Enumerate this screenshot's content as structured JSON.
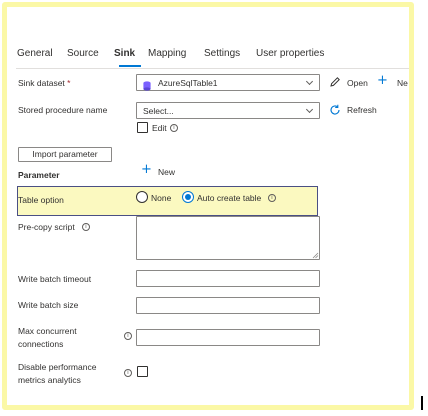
{
  "tabs": [
    {
      "label": "General"
    },
    {
      "label": "Source"
    },
    {
      "label": "Sink",
      "active": true
    },
    {
      "label": "Mapping"
    },
    {
      "label": "Settings"
    },
    {
      "label": "User properties"
    }
  ],
  "sink_dataset": {
    "label": "Sink dataset",
    "required_mark": "*",
    "value": "AzureSqlTable1",
    "open_label": "Open",
    "new_label": "Ne"
  },
  "stored_procedure": {
    "label": "Stored procedure name",
    "value": "Select...",
    "refresh_label": "Refresh",
    "edit_label": "Edit",
    "edit_checked": false
  },
  "import_parameter_label": "Import parameter",
  "parameter": {
    "label": "Parameter",
    "new_label": "New"
  },
  "table_option": {
    "label": "Table option",
    "options": [
      {
        "label": "None",
        "selected": false
      },
      {
        "label": "Auto create table",
        "selected": true
      }
    ]
  },
  "pre_copy_script": {
    "label": "Pre-copy script",
    "value": ""
  },
  "write_batch_timeout": {
    "label": "Write batch timeout",
    "value": ""
  },
  "write_batch_size": {
    "label": "Write batch size",
    "value": ""
  },
  "max_concurrent": {
    "label_line1": "Max concurrent",
    "label_line2": "connections",
    "value": ""
  },
  "disable_perf": {
    "label_line1": "Disable performance",
    "label_line2": "metrics analytics",
    "checked": false
  },
  "colors": {
    "accent": "#0078d4",
    "frame_highlight": "#fbf8a6",
    "row_highlight": "#fbf9c0",
    "row_highlight_border": "#4a4f84",
    "dataset_icon": "#7b61ff"
  },
  "icons": {
    "dataset": "database-icon",
    "open": "pencil-icon",
    "new": "plus-icon",
    "refresh": "refresh-icon",
    "info": "info-icon",
    "dropdown": "chevron-down-icon"
  }
}
